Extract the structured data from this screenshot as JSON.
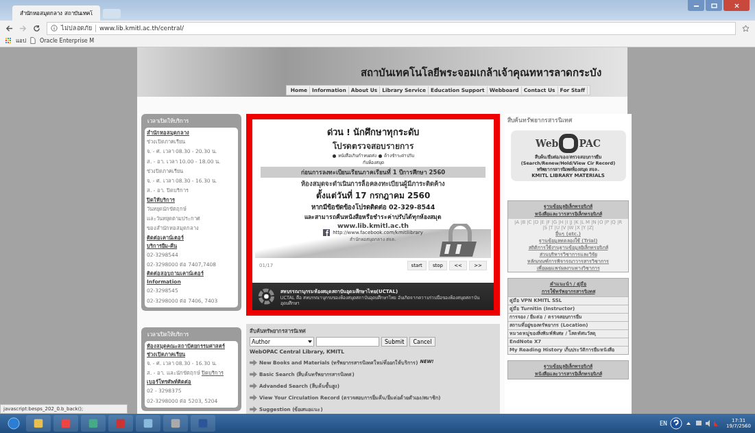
{
  "browser": {
    "tab_title": "สำนักหอสมุดกลาง สถาบันเทคโ",
    "security_label": "ไม่ปลอดภัย",
    "url": "www.lib.kmitl.ac.th/central/",
    "bookmarks": [
      "แอป",
      "Oracle Enterprise M"
    ]
  },
  "header": {
    "title": "สถาบันเทคโนโลยีพระจอมเกล้าเจ้าคุณทหารลาดกระบัง",
    "nav": [
      "Home",
      "Information",
      "About Us",
      "Library Service",
      "Education Support",
      "Webboard",
      "Contact Us",
      "For Staff"
    ]
  },
  "left_boxes": [
    {
      "title": "เวลาเปิดให้บริการ",
      "lines": [
        {
          "kind": "link",
          "text": "สำนักหอสมุดกลาง"
        },
        {
          "kind": "text",
          "text": "ช่วงเปิดภาคเรียน"
        },
        {
          "kind": "text",
          "text": "จ. - ศ. เวลา 08.30 - 20.30 น."
        },
        {
          "kind": "text",
          "text": "ส. - อา. เวลา 10.00 - 18.00 น."
        },
        {
          "kind": "text",
          "text": "ช่วงปิดภาคเรียน"
        },
        {
          "kind": "text",
          "text": "จ. - ศ. เวลา 08.30 - 16.30 น."
        },
        {
          "kind": "text",
          "text": "ส. - อา. ปิดบริการ"
        },
        {
          "kind": "link",
          "text": "ปิดให้บริการ"
        },
        {
          "kind": "text",
          "text": "วันหยุดนักขัตฤกษ์"
        },
        {
          "kind": "text",
          "text": "และวันหยุดตามประกาศ"
        },
        {
          "kind": "text",
          "text": "ของสำนักหอสมุดกลาง"
        },
        {
          "kind": "link",
          "text": "ติดต่อเคาน์เตอร์"
        },
        {
          "kind": "link",
          "text": "บริการยืม-คืน"
        },
        {
          "kind": "text",
          "text": "02-3298544"
        },
        {
          "kind": "text",
          "text": "02-3298000 ต่อ 7407,7408"
        },
        {
          "kind": "link",
          "text": "ติดต่อสอบถามเคาน์เตอร์ Information"
        },
        {
          "kind": "text",
          "text": "02-3298545"
        },
        {
          "kind": "text",
          "text": "02-3298000 ต่อ 7406, 7403"
        }
      ]
    },
    {
      "title": "เวลาเปิดให้บริการ",
      "lines": [
        {
          "kind": "link",
          "text": "ห้องสมุดคณะสถาปัตยกรรมศาสตร์"
        },
        {
          "kind": "link",
          "text": "ช่วงเปิดภาคเรียน"
        },
        {
          "kind": "text",
          "text": "จ. - ศ. เวลา 08.30 - 16.30 น."
        },
        {
          "kind": "text_link",
          "text": "ส. - อา. และนักขัตฤกษ์",
          "link": "ปิดบริการ"
        },
        {
          "kind": "link",
          "text": "เบอร์โทรศัพท์ติดต่อ"
        },
        {
          "kind": "text",
          "text": "02 - 3298375"
        },
        {
          "kind": "text",
          "text": "02-3298000 ต่อ 5203, 5204"
        }
      ]
    }
  ],
  "slideshow": {
    "headline": "ด่วน ! นักศึกษาทุกระดับ",
    "subhead": "โปรดตรวจสอบรายการ",
    "bullets": [
      "หนังสือเกินกำหนดส่ง",
      "ค้างชำระค่าปรับ"
    ],
    "bullet_tail": "กับห้องสมุด",
    "band": "ก่อนการลงทะเบียนเรียนภาคเรียนที่ 1 ปีการศึกษา 2560",
    "lines": [
      "ห้องสมุดจะดำเนินการล็อคลงทะเบียนผู้มีภาระติดค้าง",
      "ตั้งแต่วันที่ 17 กรกฎาคม 2560",
      "หากมีข้อขัดข้องโปรดติดต่อ 02-329-8544",
      "และสามารถคืนหนังสือหรือชำระค่าปรับได้ทุกห้องสมุด"
    ],
    "website": "www.lib.kmitl.ac.th",
    "facebook": "http://www.facebook.com/kmitllibrary",
    "footer": "สำนักหอสมุดกลาง สจล.",
    "counter": "01/17",
    "controls": [
      "start",
      "stop",
      "<<",
      ">>"
    ]
  },
  "uctal": {
    "title": "สหบรรณานุกรมห้องสมุดสถาบันอุดมศึกษาไทย(UCTAL)",
    "description": "UCTAL คือ สหบรรณานุกรมของห้องสมุดสถาบันอุดมศึกษาไทย อันเกิดจากความร่วมมือของห้องสมุดสถาบันอุดมศึกษา"
  },
  "search": {
    "title": "สืบค้นทรัพยากรสารนิเทศ",
    "field_select": "Author",
    "buttons": [
      "Submit",
      "Cancel"
    ],
    "catalog": "WebOPAC Central Library, KMITL",
    "links": [
      {
        "text": "New Books and Materials (ทรัพยากรสารนิเทศใหม่ที่ออกให้บริการ)",
        "badge": "NEW!"
      },
      {
        "text": "Basic Search (สืบค้นทรัพยากรสารนิเทศ)"
      },
      {
        "text": "Advanded Search (สืบค้นขั้นสูง)"
      },
      {
        "text": "View Your Circulation Record (ตรวจสอบการยืมคืน/ยืมต่อด้วยตัวเอง/สมาชิก)"
      },
      {
        "text": "Suggestion (ข้อเสนอแนะ)"
      }
    ]
  },
  "right": {
    "heading": "สืบค้นทรัพยากรสารนิเทศ",
    "opac_logo": {
      "wordmark_left": "Web",
      "wordmark_right": "PAC",
      "lines": [
        "สืบค้น/ยืมต่อ/จอง/ตรวจสอบการยืม",
        "(Search/Renew/Hold/View Cir Record)",
        "ทรัพยากรสารนิเทศห้องสมุด สจล.",
        "KMITL LIBRARY MATERIALS"
      ]
    },
    "databases": {
      "header": [
        "ฐานข้อมูลอิเล็กทรอนิกส์",
        "หนังสือและวารสารอิเล็กทรอนิกส์"
      ],
      "letters": [
        "|A",
        "|B",
        "|C",
        "|D",
        "|E",
        "|F",
        "|G",
        "|H",
        "|I",
        "|J",
        "|K",
        "|L",
        "M",
        "|N",
        "|O",
        "|P",
        "|Q",
        "|R",
        "|S",
        "|T",
        "|U",
        "|V",
        "|W",
        "|X",
        "|Y",
        "|Z|"
      ],
      "links": [
        "อื่นๆ (etc.)",
        "ฐานข้อมูลทดลองใช้ (Trial)",
        "สถิติการใช้งานฐานข้อมูลอิเล็กทรอนิกส์",
        "ส่วนบริหารวิชาการและวิจัย",
        "หลักเกณฑ์การพิจารณาวารสารวิชาการ",
        "เพื่อเผยแพร่ผลงานทางวิชาการ"
      ]
    },
    "guides": {
      "header": [
        "คำแนะนำ / คู่มือ",
        "การใช้ทรัพยากรสารนิเทศ"
      ],
      "rows": [
        "คู่มือ VPN KMITL SSL",
        "คู่มือ Turnitin (Instructor)",
        "การจอง / ยืมต่อ / ตรวจสอบการยืม",
        "สถานที่อยู่ของทรัพยากร (Location)",
        "หมวดหมู่ของสิ่งพิมพ์พิเศษ / โสตทัศนวัสดุ",
        "EndNote X7",
        "My Reading History เก็บประวัติการยืมหนังสือ"
      ]
    },
    "more_header": [
      "ฐานข้อมูลอิเล็กทรอนิกส์",
      "หนังสือและวารสารอิเล็กทรอนิกส์"
    ]
  },
  "status_link": "javascript:besps_202_0.b_back();",
  "taskbar": {
    "language": "EN",
    "time": "17:31",
    "date": "19/7/2560"
  }
}
